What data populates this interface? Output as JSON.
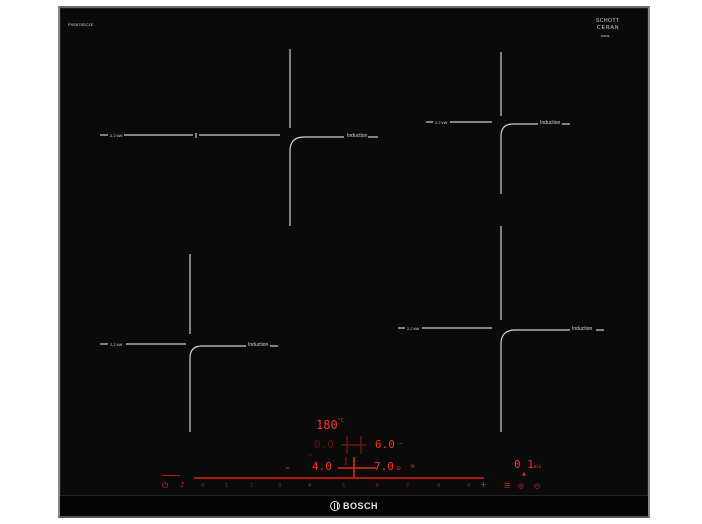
{
  "hob": {
    "model": "PXE675DC1E",
    "glass_brand_line1": "SCHOTT",
    "glass_brand_line2": "CERAN",
    "glass_brand_line3": "MADE",
    "brand": "BOSCH"
  },
  "zones": {
    "top_left": {
      "power": "2,2 kW",
      "label": "Induction"
    },
    "top_right": {
      "power": "2,2 kW",
      "label": "Induction"
    },
    "bottom_left": {
      "power": "2,2 kW",
      "label": "Induction"
    },
    "bottom_right": {
      "power": "2,2 kW",
      "label": "Induction"
    }
  },
  "display": {
    "temperature": "180",
    "temperature_unit": "°C",
    "zone_top_left_level": "0.0",
    "zone_top_right_level": "6.0",
    "zone_bottom_left_level": "4.0",
    "zone_bottom_right_level": "7.0",
    "timer": "0 1",
    "timer_unit": "min"
  },
  "controls": {
    "power_symbol": "⏻",
    "slider_numbers": [
      "0",
      "1",
      "2",
      "3",
      "4",
      "5",
      "6",
      "7",
      "8",
      "9"
    ],
    "plus_symbol": "+"
  },
  "colors": {
    "glass": "#0a0a0a",
    "display_red": "#ff3020",
    "frame": "#8a8a8a",
    "print": "#d8d8d8"
  }
}
